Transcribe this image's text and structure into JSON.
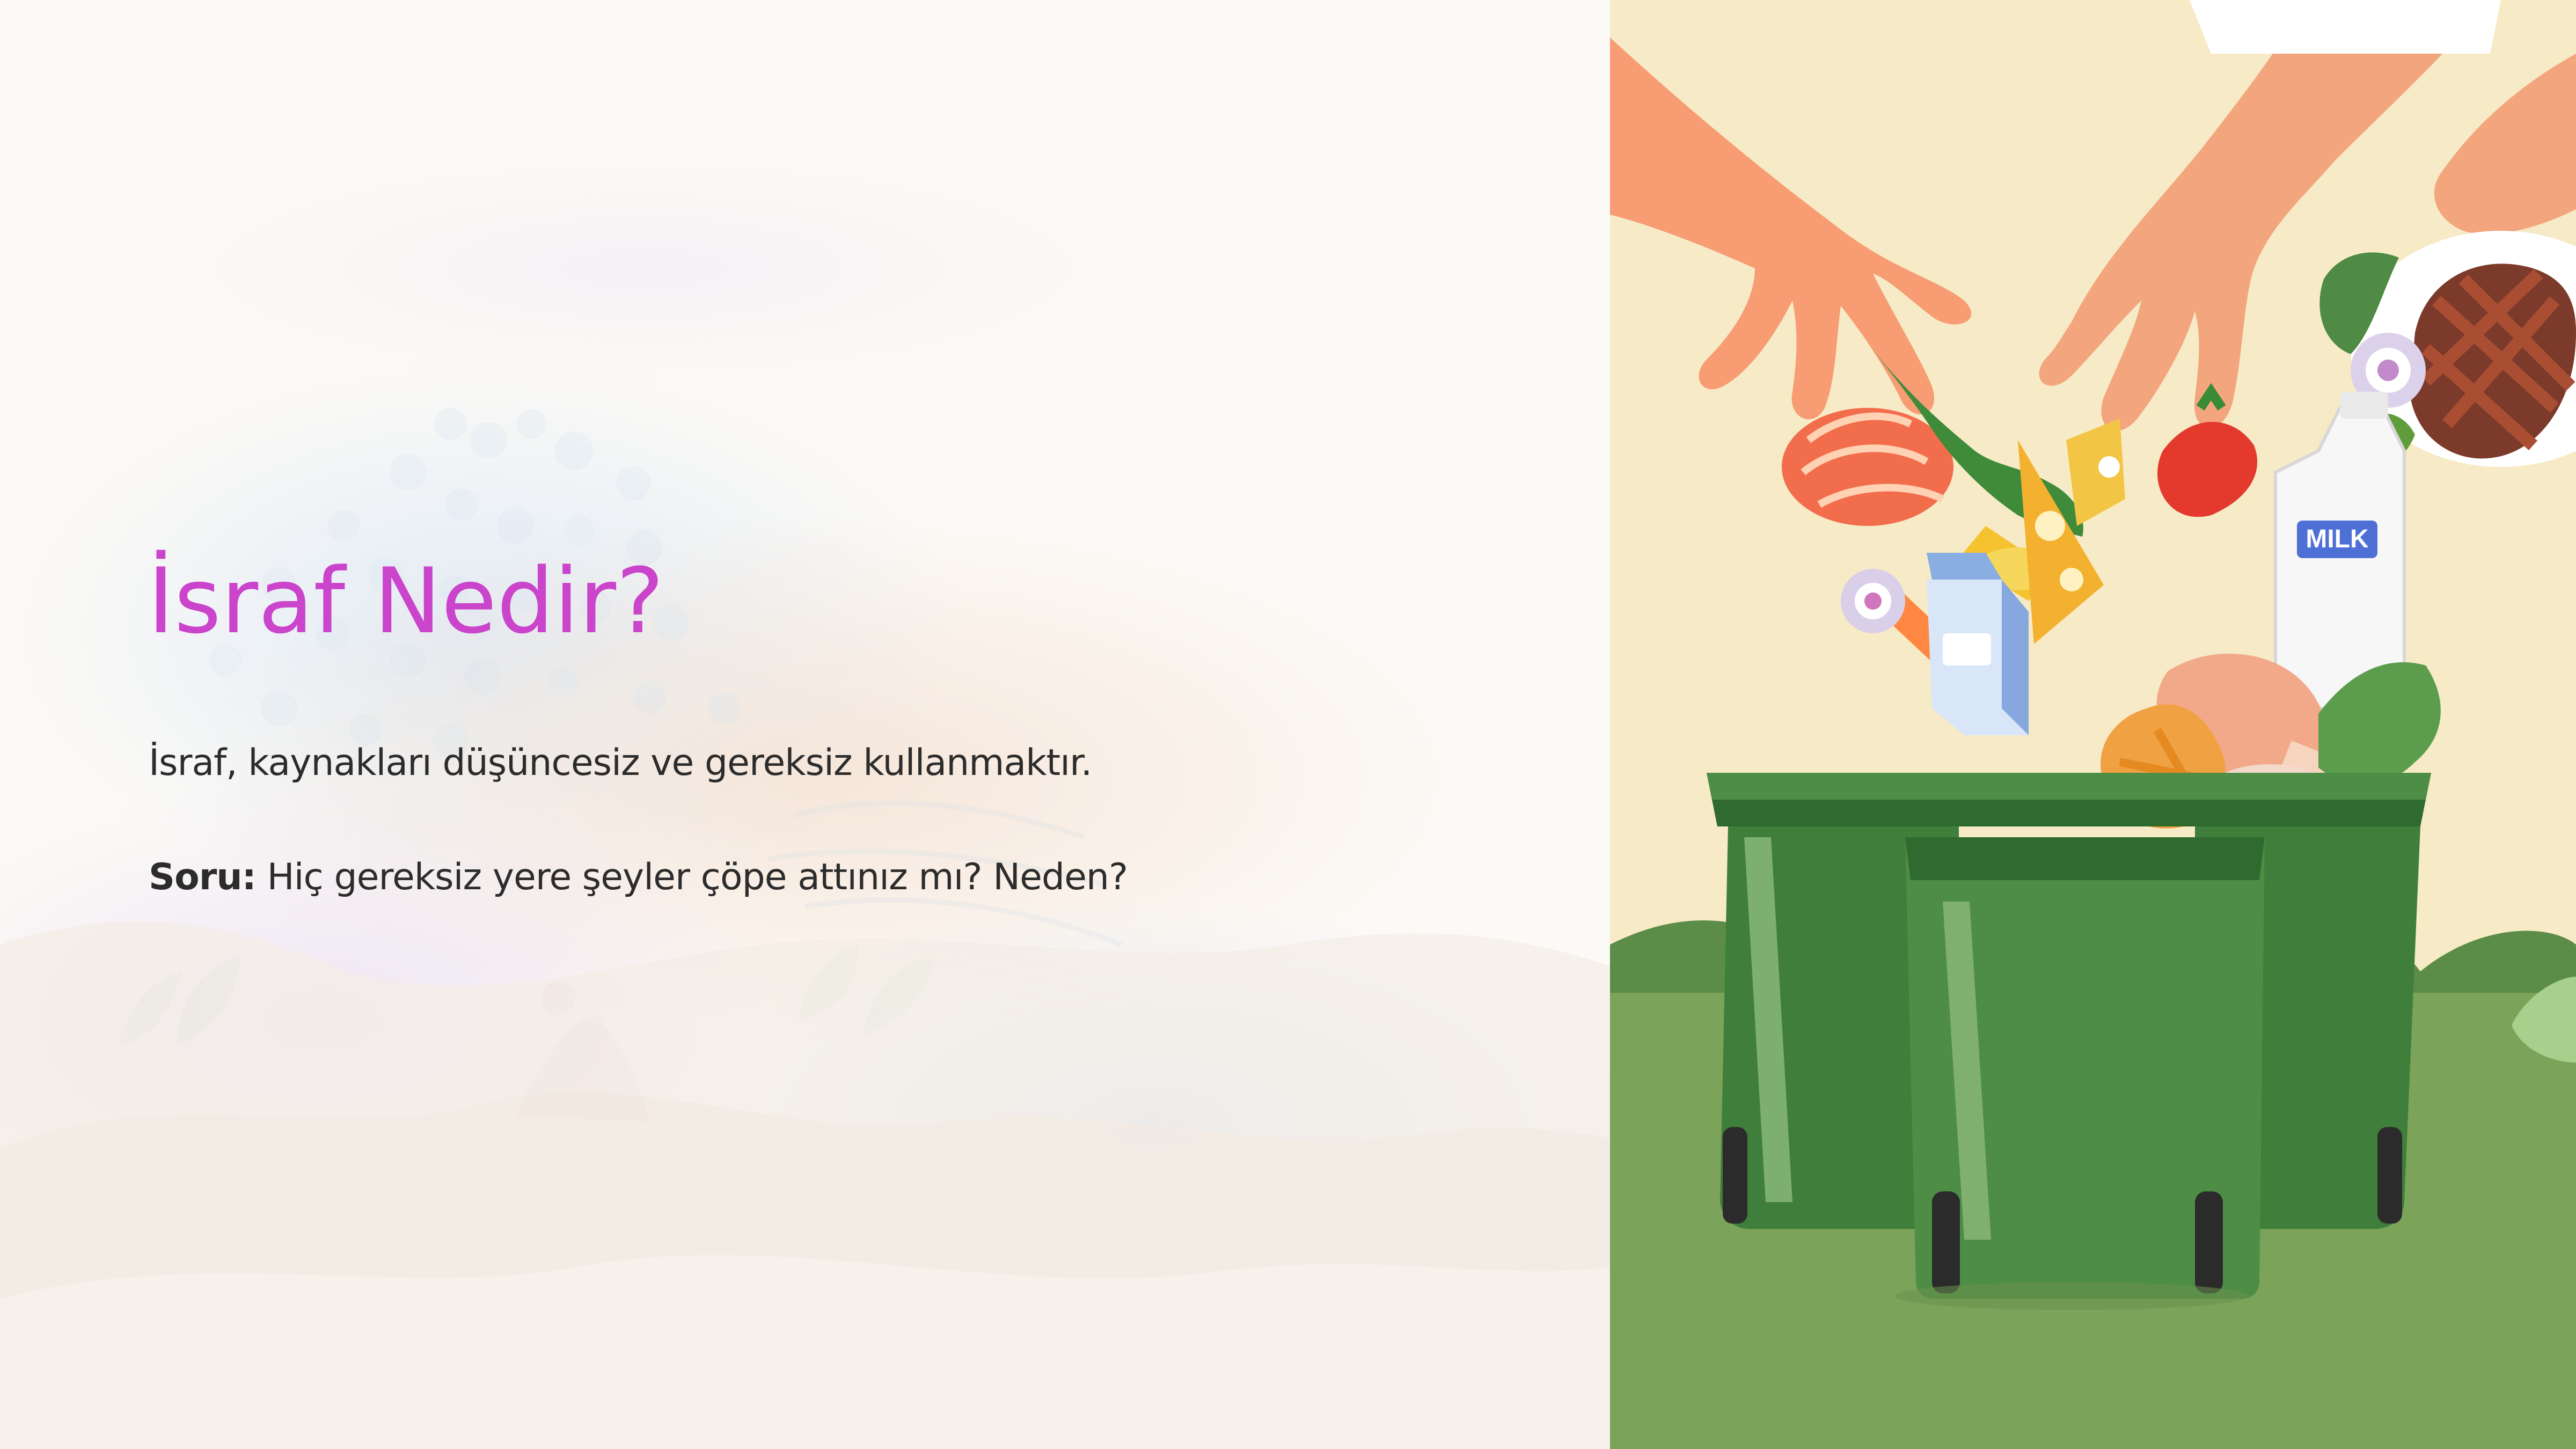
{
  "slide": {
    "title": "İsraf Nedir?",
    "body": {
      "line1": "İsraf, kaynakları düşüncesiz ve gereksiz kullanmaktır.",
      "question_label": "Soru:",
      "question_text": " Hiç gereksiz yere şeyler çöpe attınız mı? Neden?"
    },
    "illustration": {
      "milk_label": "MILK"
    }
  },
  "colors": {
    "title": "#cb44cc",
    "body_text": "#2c2c2c",
    "illustration_background": "#f6ebc6",
    "grass": "#7ba35a",
    "bin": "#3f7f3b"
  },
  "icons": {
    "food_waste_illustration": "food-waste-illustration"
  }
}
